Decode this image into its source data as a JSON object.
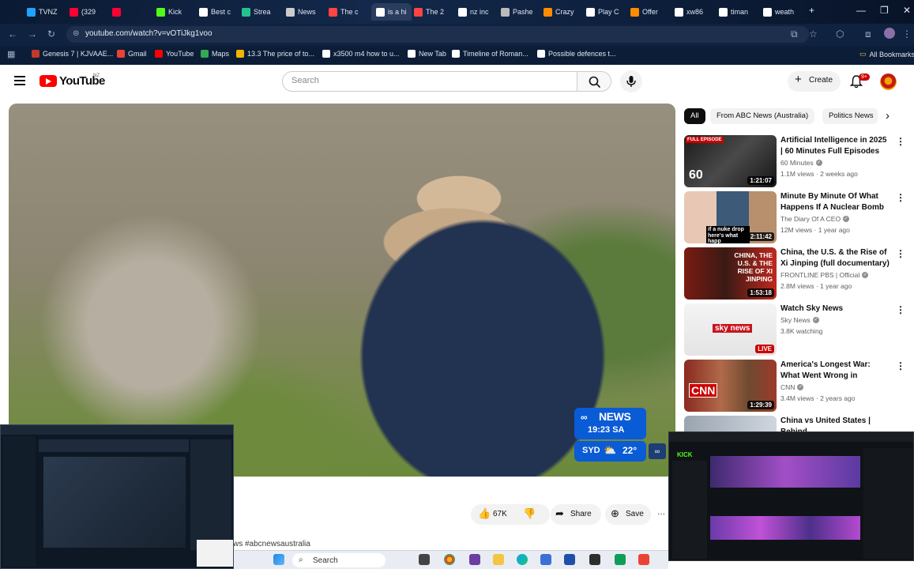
{
  "browser": {
    "tabs": [
      {
        "label": "TVNZ",
        "color": "#1fa3ff"
      },
      {
        "label": "(329",
        "color": "#ff0033"
      },
      {
        "label": "",
        "color": "#ff0033"
      },
      {
        "label": "Kick",
        "color": "#53fc18"
      },
      {
        "label": "Best c",
        "color": "#ffffff"
      },
      {
        "label": "Strea",
        "color": "#24c28f"
      },
      {
        "label": "News",
        "color": "#cccccc"
      },
      {
        "label": "The c",
        "color": "#ff4444"
      },
      {
        "label": "is a hi",
        "color": "#ffffff"
      },
      {
        "label": "The 2",
        "color": "#ff4444"
      },
      {
        "label": "nz inc",
        "color": "#ffffff"
      },
      {
        "label": "Pashe",
        "color": "#bbbbbb"
      },
      {
        "label": "Crazy",
        "color": "#ff8c00"
      },
      {
        "label": "Play C",
        "color": "#ffffff"
      },
      {
        "label": "Offer",
        "color": "#ff8c00"
      },
      {
        "label": "xw86",
        "color": "#ffffff"
      },
      {
        "label": "timan",
        "color": "#ffffff"
      },
      {
        "label": "weath",
        "color": "#ffffff"
      }
    ],
    "new_tab_glyph": "+",
    "url": "youtube.com/watch?v=vOTiJkg1voo",
    "bookmarks": [
      {
        "label": "Genesis 7 | KJVAAE...",
        "color": "#c0392b"
      },
      {
        "label": "Gmail",
        "color": "#ea4335"
      },
      {
        "label": "YouTube",
        "color": "#ff0000"
      },
      {
        "label": "Maps",
        "color": "#34a853"
      },
      {
        "label": "13.3 The price of to...",
        "color": "#f4b400"
      },
      {
        "label": "x3500 m4 how to u...",
        "color": "#ffffff"
      },
      {
        "label": "New Tab",
        "color": "#ffffff"
      },
      {
        "label": "Timeline of Roman...",
        "color": "#ffffff"
      },
      {
        "label": "Possible defences t...",
        "color": "#ffffff"
      }
    ],
    "all_bookmarks": "All Bookmarks"
  },
  "youtube": {
    "logo_text": "YouTube",
    "region": "NZ",
    "search_placeholder": "Search",
    "create_label": "Create",
    "notifications_badge": "9+"
  },
  "player": {
    "channel_bug": "NEWS",
    "clock": "19:23 SA",
    "weather_city": "SYD",
    "weather_temp": "22°",
    "weather_icon": "⛅"
  },
  "actions": {
    "likes": "67K",
    "share": "Share",
    "save": "Save",
    "more": "···"
  },
  "description_tags": "ws #abcnewsaustralia",
  "chips": [
    "All",
    "From ABC News (Australia)",
    "Politics News"
  ],
  "recommendations": [
    {
      "title": "Artificial Intelligence in 2025 | 60 Minutes Full Episodes",
      "channel": "60 Minutes",
      "meta": "1.1M views · 2 weeks ago",
      "duration": "1:21:07",
      "badge": "FULL EPISODE",
      "thumb_text": "60"
    },
    {
      "title": "Minute By Minute Of What Happens If A Nuclear Bomb ...",
      "channel": "The Diary Of A CEO",
      "meta": "12M views · 1 year ago",
      "duration": "2:11:42",
      "badge": "",
      "thumb_text": "if a nuke drop here's what happ"
    },
    {
      "title": "China, the U.S. & the Rise of Xi Jinping (full documentary) | ...",
      "channel": "FRONTLINE PBS | Official",
      "meta": "2.8M views · 1 year ago",
      "duration": "1:53:18",
      "badge": "",
      "thumb_text": "CHINA, THE U.S. & THE RISE OF XI JINPING"
    },
    {
      "title": "Watch Sky News",
      "channel": "Sky News",
      "meta": "3.8K watching",
      "duration": "LIVE",
      "badge": "",
      "thumb_text": "sky news"
    },
    {
      "title": "America's Longest War: What Went Wrong in Afghanistan ...",
      "channel": "CNN",
      "meta": "3.4M views · 2 years ago",
      "duration": "1:29:39",
      "badge": "",
      "thumb_text": "CNN"
    },
    {
      "title": "China vs United States | Behind",
      "channel": "",
      "meta": "",
      "duration": "",
      "badge": "",
      "thumb_text": ""
    }
  ],
  "taskbar": {
    "search_label": "Search"
  },
  "overlay_right": {
    "brand": "KICK"
  }
}
